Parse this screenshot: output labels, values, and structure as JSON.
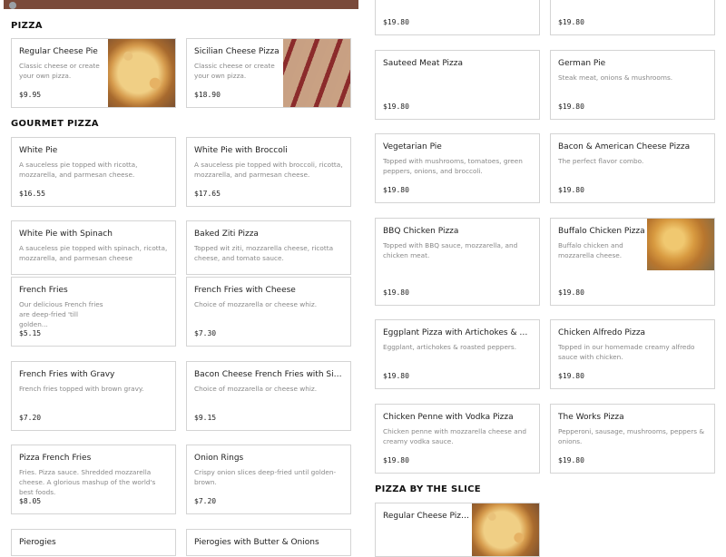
{
  "sections": {
    "pizza": "PIZZA",
    "gourmet": "GOURMET PIZZA",
    "by_slice": "PIZZA BY THE SLICE"
  },
  "left": {
    "regular_cheese": {
      "name": "Regular Cheese Pie",
      "desc": "Classic cheese or create your own pizza.",
      "price": "$9.95"
    },
    "sicilian": {
      "name": "Sicilian Cheese Pizza",
      "desc": "Classic cheese or create your own pizza.",
      "price": "$18.90"
    },
    "white_pie": {
      "name": "White Pie",
      "desc": "A sauceless pie topped with ricotta, mozzarella, and parmesan cheese.",
      "price": "$16.55"
    },
    "white_broccoli": {
      "name": "White Pie with Broccoli",
      "desc": "A sauceless pie topped with broccoli, ricotta, mozzarella, and parmesan cheese.",
      "price": "$17.65"
    },
    "white_spinach": {
      "name": "White Pie with Spinach",
      "desc": "A sauceless pie topped with spinach, ricotta, mozzarella, and parmesan cheese",
      "price": ""
    },
    "baked_ziti": {
      "name": "Baked Ziti Pizza",
      "desc": "Topped wit ziti, mozzarella cheese, ricotta cheese, and tomato sauce.",
      "price": ""
    },
    "french_fries": {
      "name": "French Fries",
      "desc": "Our delicious French fries are deep-fried 'till golden...",
      "price": "$5.15"
    },
    "fries_cheese": {
      "name": "French Fries with Cheese",
      "desc": "Choice of mozzarella or cheese whiz.",
      "price": "$7.30"
    },
    "fries_gravy": {
      "name": "French Fries with Gravy",
      "desc": "French fries topped with brown gravy.",
      "price": "$7.20"
    },
    "bacon_fries": {
      "name": "Bacon Cheese French Fries with Side of...",
      "desc": "Choice of mozzarella or cheese whiz.",
      "price": "$9.15"
    },
    "pizza_fries": {
      "name": "Pizza French Fries",
      "desc": "Fries. Pizza sauce. Shredded mozzarella cheese. A glorious mashup of the world's best foods.",
      "price": "$8.05"
    },
    "onion_rings": {
      "name": "Onion Rings",
      "desc": "Crispy onion slices deep-fried until golden-brown.",
      "price": "$7.20"
    },
    "pierogies": {
      "name": "Pierogies"
    },
    "pierogies_butter": {
      "name": "Pierogies with Butter & Onions"
    }
  },
  "right": {
    "top_a": {
      "price": "$19.80"
    },
    "top_b": {
      "price": "$19.80"
    },
    "sauteed_meat": {
      "name": "Sauteed Meat Pizza",
      "desc": "",
      "price": "$19.80"
    },
    "german_pie": {
      "name": "German Pie",
      "desc": "Steak meat, onions & mushrooms.",
      "price": "$19.80"
    },
    "vegetarian": {
      "name": "Vegetarian Pie",
      "desc": "Topped with mushrooms, tomatoes, green peppers, onions, and broccoli.",
      "price": "$19.80"
    },
    "bacon_american": {
      "name": "Bacon & American Cheese Pizza",
      "desc": "The perfect flavor combo.",
      "price": "$19.80"
    },
    "bbq_chicken": {
      "name": "BBQ Chicken Pizza",
      "desc": "Topped with BBQ sauce, mozzarella, and chicken meat.",
      "price": "$19.80"
    },
    "buffalo_chicken": {
      "name": "Buffalo Chicken Pizza",
      "desc": "Buffalo chicken and mozzarella cheese.",
      "price": "$19.80"
    },
    "eggplant": {
      "name": "Eggplant Pizza with Artichokes & Roasted...",
      "desc": "Eggplant, artichokes & roasted peppers.",
      "price": "$19.80"
    },
    "chicken_alfredo": {
      "name": "Chicken Alfredo Pizza",
      "desc": "Topped in our homemade creamy alfredo sauce with chicken.",
      "price": "$19.80"
    },
    "chicken_penne": {
      "name": "Chicken Penne with Vodka Pizza",
      "desc": "Chicken penne with mozzarella cheese and creamy vodka sauce.",
      "price": "$19.80"
    },
    "works": {
      "name": "The Works Pizza",
      "desc": "Pepperoni, sausage, mushrooms, peppers & onions.",
      "price": "$19.80"
    },
    "slice_regular": {
      "name": "Regular Cheese Pizza..."
    }
  }
}
